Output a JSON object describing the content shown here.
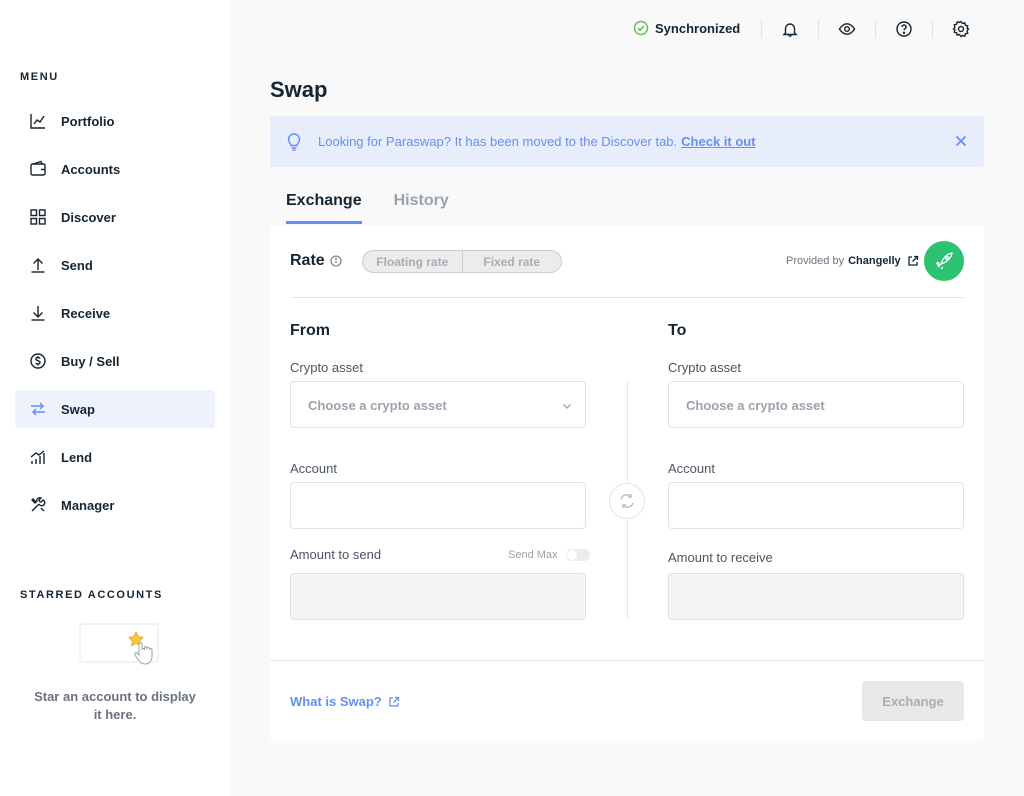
{
  "sidebar": {
    "menu_title": "MENU",
    "items": [
      {
        "label": "Portfolio",
        "icon": "chart-line-icon"
      },
      {
        "label": "Accounts",
        "icon": "wallet-icon"
      },
      {
        "label": "Discover",
        "icon": "grid-icon"
      },
      {
        "label": "Send",
        "icon": "arrow-up-icon"
      },
      {
        "label": "Receive",
        "icon": "arrow-down-icon"
      },
      {
        "label": "Buy / Sell",
        "icon": "dollar-icon"
      },
      {
        "label": "Swap",
        "icon": "swap-icon",
        "active": true
      },
      {
        "label": "Lend",
        "icon": "lend-icon"
      },
      {
        "label": "Manager",
        "icon": "tools-icon"
      }
    ],
    "starred_title": "STARRED ACCOUNTS",
    "starred_empty_text": "Star an account to display it here."
  },
  "topbar": {
    "sync_label": "Synchronized"
  },
  "page": {
    "title": "Swap"
  },
  "banner": {
    "text": "Looking for Paraswap? It has been moved to the Discover tab.",
    "link": "Check it out"
  },
  "tabs": [
    {
      "label": "Exchange",
      "active": true
    },
    {
      "label": "History",
      "active": false
    }
  ],
  "card": {
    "rate_label": "Rate",
    "rate_options": [
      "Floating rate",
      "Fixed rate"
    ],
    "provided_by": "Provided by",
    "provider_name": "Changelly",
    "from": {
      "title": "From",
      "asset_label": "Crypto asset",
      "asset_placeholder": "Choose a crypto asset",
      "account_label": "Account",
      "amount_label": "Amount to send",
      "send_max_label": "Send Max"
    },
    "to": {
      "title": "To",
      "asset_label": "Crypto asset",
      "asset_placeholder": "Choose a crypto asset",
      "account_label": "Account",
      "amount_label": "Amount to receive"
    },
    "what_is_link": "What is Swap?",
    "exchange_button": "Exchange"
  },
  "colors": {
    "accent": "#6490f1",
    "success": "#66be54",
    "provider_green": "#2dc26f"
  }
}
